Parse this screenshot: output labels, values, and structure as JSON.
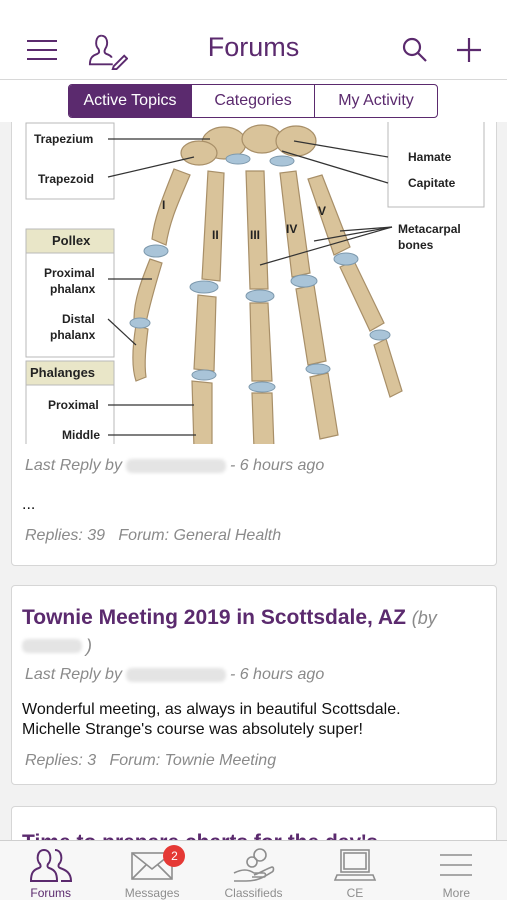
{
  "header": {
    "title": "Forums"
  },
  "segments": [
    "Active Topics",
    "Categories",
    "My Activity"
  ],
  "posts": [
    {
      "figure_labels": {
        "trapezium": "Trapezium",
        "trapezoid": "Trapezoid",
        "pollex": "Pollex",
        "proximal_phalanx": "Proximal\nphalanx",
        "proximal_phalanx_1": "Proximal",
        "proximal_phalanx_2": "phalanx",
        "distal_phalanx_1": "Distal",
        "distal_phalanx_2": "phalanx",
        "phalanges": "Phalanges",
        "proximal": "Proximal",
        "middle": "Middle",
        "hamate": "Hamate",
        "capitate": "Capitate",
        "metacarpal_1": "Metacarpal",
        "metacarpal_2": "bones",
        "roman_1": "I",
        "roman_2": "II",
        "roman_3": "III",
        "roman_4": "IV",
        "roman_5": "V"
      },
      "last_reply_prefix": "Last Reply by",
      "last_reply_time": "- 6 hours ago",
      "excerpt": "...",
      "replies": "Replies: 39",
      "forum": "Forum: General Health"
    },
    {
      "title": "Townie Meeting 2019 in Scottsdale, AZ",
      "by": "(by",
      "by_close": ")",
      "last_reply_prefix": "Last Reply by",
      "last_reply_time": "- 6 hours ago",
      "excerpt_line1": "Wonderful meeting, as always in beautiful Scottsdale.",
      "excerpt_line2": "Michelle Strange's course was absolutely super!",
      "replies": "Replies: 3",
      "forum": "Forum: Townie Meeting"
    },
    {
      "title": "Time to prepare charts for the day's"
    }
  ],
  "tabbar": {
    "items": [
      {
        "label": "Forums",
        "icon": "forums-icon"
      },
      {
        "label": "Messages",
        "icon": "messages-icon",
        "badge": "2"
      },
      {
        "label": "Classifieds",
        "icon": "classifieds-icon"
      },
      {
        "label": "CE",
        "icon": "ce-laptop-icon"
      },
      {
        "label": "More",
        "icon": "more-icon"
      }
    ]
  },
  "colors": {
    "accent": "#5b2a6e",
    "badge": "#e53935"
  }
}
